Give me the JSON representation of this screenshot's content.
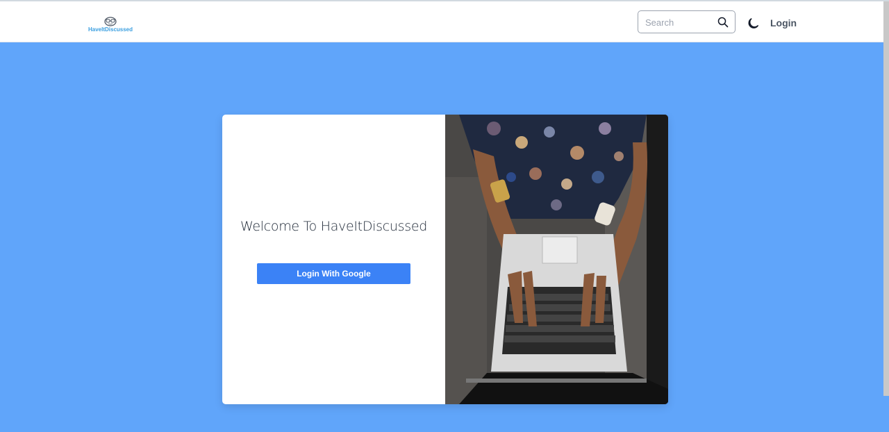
{
  "header": {
    "logo_text": "HaveItDiscussed",
    "search_placeholder": "Search",
    "login_label": "Login"
  },
  "card": {
    "welcome_text": "Welcome To HaveItDiscussed",
    "google_button_label": "Login With Google"
  },
  "icons": {
    "logo": "logo-icon",
    "search": "search-icon",
    "theme_toggle": "moon-icon"
  },
  "colors": {
    "background": "#60a5fa",
    "accent": "#3b82f6",
    "logo_text": "#3b9fe0"
  }
}
